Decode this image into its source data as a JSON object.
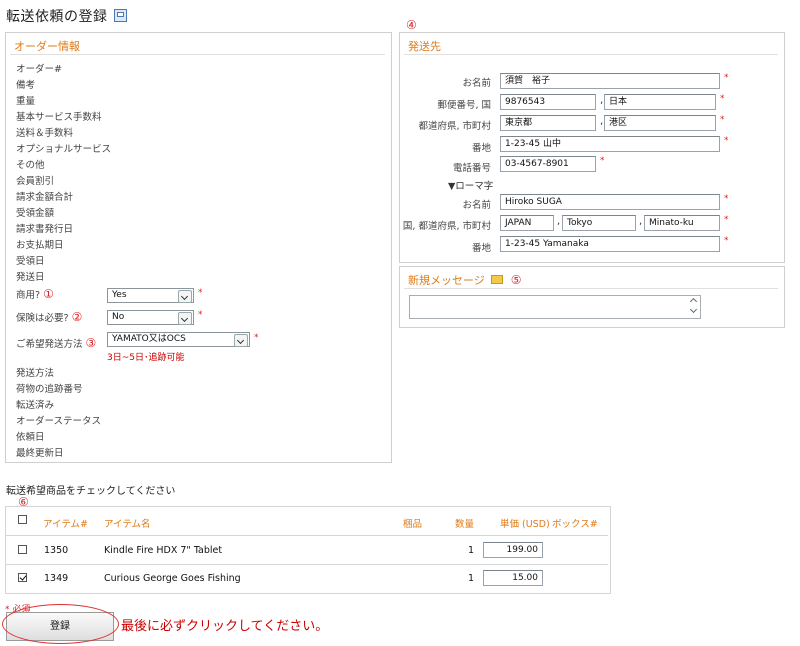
{
  "page": {
    "title": "転送依頼の登録"
  },
  "order_info": {
    "legend": "オーダー情報",
    "labels": [
      "オーダー#",
      "備考",
      "重量",
      "基本サービス手数料",
      "送料＆手数料",
      "オプショナルサービス",
      "その他",
      "会員割引",
      "請求金額合計",
      "受領金額",
      "請求書発行日",
      "お支払期日",
      "受領日",
      "発送日"
    ],
    "commercial": {
      "label": "商用?",
      "marker": "①",
      "value": "Yes"
    },
    "insurance": {
      "label": "保険は必要?",
      "marker": "②",
      "value": "No"
    },
    "shipping_method": {
      "label": "ご希望発送方法",
      "marker": "③",
      "value": "YAMATO又はOCS",
      "note": "3日~5日･追跡可能"
    },
    "labels_after": [
      "発送方法",
      "荷物の追跡番号",
      "転送済み",
      "オーダーステータス",
      "依頼日",
      "最終更新日"
    ]
  },
  "destination": {
    "marker": "④",
    "legend": "発送先",
    "name": {
      "label": "お名前",
      "value": "須賀　裕子"
    },
    "postal": {
      "label": "郵便番号, 国",
      "postal": "9876543",
      "country": "日本"
    },
    "prefecture": {
      "label": "都道府県, 市町村",
      "prefecture": "東京都",
      "city": "港区"
    },
    "address": {
      "label": "番地",
      "value": "1-23-45 山中"
    },
    "phone": {
      "label": "電話番号",
      "value": "03-4567-8901"
    },
    "romaji_toggle": "▼ローマ字",
    "romaji_name": {
      "label": "お名前",
      "value": "Hiroko SUGA"
    },
    "romaji_country": {
      "label": "国, 都道府県, 市町村",
      "country": "JAPAN",
      "prefecture": "Tokyo",
      "city": "Minato-ku"
    },
    "romaji_address": {
      "label": "番地",
      "value": "1-23-45 Yamanaka"
    }
  },
  "message": {
    "legend": "新規メッセージ",
    "marker": "⑤",
    "icon": "envelope-icon"
  },
  "products": {
    "heading": "転送希望商品をチェックしてください",
    "marker": "⑥",
    "columns": [
      "アイテム#",
      "アイテム名",
      "梱品",
      "数量",
      "単価 (USD)",
      "ボックス#"
    ],
    "rows": [
      {
        "checked": false,
        "item": "1350",
        "name": "Kindle Fire HDX 7\" Tablet",
        "qty": "1",
        "price": "199.00"
      },
      {
        "checked": true,
        "item": "1349",
        "name": "Curious George Goes Fishing",
        "qty": "1",
        "price": "15.00"
      }
    ]
  },
  "footer": {
    "required_note": "* 必須",
    "submit_label": "登録",
    "instruction": "最後に必ずクリックしてください。"
  },
  "colors": {
    "accent": "#e07a18",
    "marker_red": "#d22222"
  }
}
